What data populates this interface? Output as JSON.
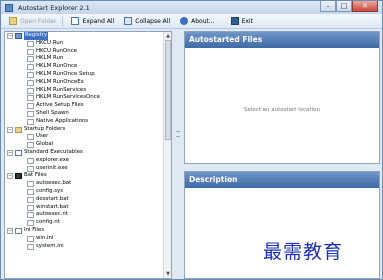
{
  "window": {
    "title": "Autostart Explorer 2.1"
  },
  "toolbar": {
    "open_folder": "Open Folder",
    "expand_all": "Expand All",
    "collapse_all": "Collapse All",
    "about": "About...",
    "exit": "Exit"
  },
  "tree": [
    {
      "label": "Registry",
      "level": 0,
      "expand": "−",
      "icon": "registry-icon",
      "selected": true
    },
    {
      "label": "HKCU Run",
      "level": 1,
      "icon": "key-icon"
    },
    {
      "label": "HKCU RunOnce",
      "level": 1,
      "icon": "key-icon"
    },
    {
      "label": "HKLM Run",
      "level": 1,
      "icon": "key-icon"
    },
    {
      "label": "HKLM RunOnce",
      "level": 1,
      "icon": "key-icon"
    },
    {
      "label": "HKLM RunOnce Setup",
      "level": 1,
      "icon": "key-icon"
    },
    {
      "label": "HKLM RunOnceEx",
      "level": 1,
      "icon": "key-icon"
    },
    {
      "label": "HKLM RunServices",
      "level": 1,
      "icon": "key-icon"
    },
    {
      "label": "HKLM RunServicesOnce",
      "level": 1,
      "icon": "key-icon"
    },
    {
      "label": "Active Setup Files",
      "level": 1,
      "icon": "key-icon"
    },
    {
      "label": "Shell Spawn",
      "level": 1,
      "icon": "key-icon"
    },
    {
      "label": "Native Applications",
      "level": 1,
      "icon": "key-icon"
    },
    {
      "label": "Startup Folders",
      "level": 0,
      "expand": "−",
      "icon": "folder-icon"
    },
    {
      "label": "User",
      "level": 1,
      "icon": "key-icon"
    },
    {
      "label": "Global",
      "level": 1,
      "icon": "key-icon"
    },
    {
      "label": "Standard Executables",
      "level": 0,
      "expand": "−",
      "icon": "executable-icon"
    },
    {
      "label": "explorer.exe",
      "level": 1,
      "icon": "key-icon"
    },
    {
      "label": "userinit.exe",
      "level": 1,
      "icon": "key-icon"
    },
    {
      "label": "Bat Files",
      "level": 0,
      "expand": "−",
      "icon": "batch-icon"
    },
    {
      "label": "autoexec.bat",
      "level": 1,
      "icon": "key-icon"
    },
    {
      "label": "config.sys",
      "level": 1,
      "icon": "key-icon"
    },
    {
      "label": "dosstart.bat",
      "level": 1,
      "icon": "key-icon"
    },
    {
      "label": "winstart.bat",
      "level": 1,
      "icon": "key-icon"
    },
    {
      "label": "autoexec.nt",
      "level": 1,
      "icon": "key-icon"
    },
    {
      "label": "config.nt",
      "level": 1,
      "icon": "key-icon"
    },
    {
      "label": "Ini Files",
      "level": 0,
      "expand": "−",
      "icon": "ini-icon"
    },
    {
      "label": "win.ini",
      "level": 1,
      "icon": "key-icon"
    },
    {
      "label": "system.ini",
      "level": 1,
      "icon": "key-icon"
    }
  ],
  "autostarted": {
    "title": "Autostarted Files",
    "empty_message": "Select an autostart location"
  },
  "description": {
    "title": "Description"
  },
  "watermark": "最需教育",
  "colors": {
    "accent": "#3f6aa5",
    "selection": "#3a6fc4"
  }
}
